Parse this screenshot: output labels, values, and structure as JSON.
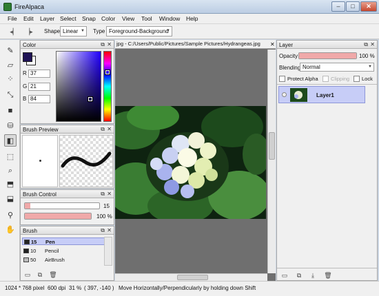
{
  "window": {
    "title": "FireAlpaca",
    "min": "–",
    "max": "□",
    "close": "✕"
  },
  "menu": [
    "File",
    "Edit",
    "Layer",
    "Select",
    "Snap",
    "Color",
    "View",
    "Tool",
    "Window",
    "Help"
  ],
  "toolbar": {
    "undo_icon": "undo-arrow-icon",
    "redo_icon": "redo-arrow-icon",
    "shape_label": "Shape",
    "shape_value": "Linear",
    "type_label": "Type",
    "type_value": "Foreground-Background"
  },
  "tools": [
    "pen-icon",
    "eraser-icon",
    "dot-pen-icon",
    "move-icon",
    "fill-icon",
    "bucket-icon",
    "gradient-icon",
    "select-rect-icon",
    "zoom-icon",
    "select-pen-icon",
    "select-eraser-icon",
    "eyedropper-icon",
    "hand-icon"
  ],
  "color_panel": {
    "title": "Color",
    "foreground": "#1f1355",
    "background": "#ffffff",
    "r_label": "R",
    "r": "37",
    "g_label": "G",
    "g": "21",
    "b_label": "B",
    "b": "84"
  },
  "brush_preview": {
    "title": "Brush Preview"
  },
  "brush_control": {
    "title": "Brush Control",
    "size": "15",
    "size_fraction": 0.07,
    "opacity": "100 %",
    "opacity_fraction": 1.0
  },
  "brush_panel": {
    "title": "Brush",
    "items": [
      {
        "size": "15",
        "name": "Pen",
        "selected": true
      },
      {
        "size": "10",
        "name": "Pencil",
        "selected": false
      },
      {
        "size": "50",
        "name": "AirBrush",
        "selected": false
      }
    ]
  },
  "canvas": {
    "tab_title": "jpg - C:/Users/Public/Pictures/Sample Pictures/Hydrangeas.jpg",
    "close": "✕"
  },
  "layer_panel": {
    "title": "Layer",
    "opacity_label": "Opacity",
    "opacity_value": "100 %",
    "opacity_fraction": 1.0,
    "blending_label": "Blending",
    "blending_value": "Normal",
    "protect_alpha": "Protect Alpha",
    "clipping": "Clipping",
    "lock": "Lock",
    "layers": [
      {
        "name": "Layer1"
      }
    ]
  },
  "panel_buttons": {
    "float": "⧉",
    "close": "✕"
  },
  "status": {
    "image_size": "1024 * 768 pixel",
    "dpi": "600 dpi",
    "zoom": "31 %",
    "coords": "( 397, -140 )",
    "hint": "Move Horizontally/Perpendicularly by holding down Shift"
  }
}
